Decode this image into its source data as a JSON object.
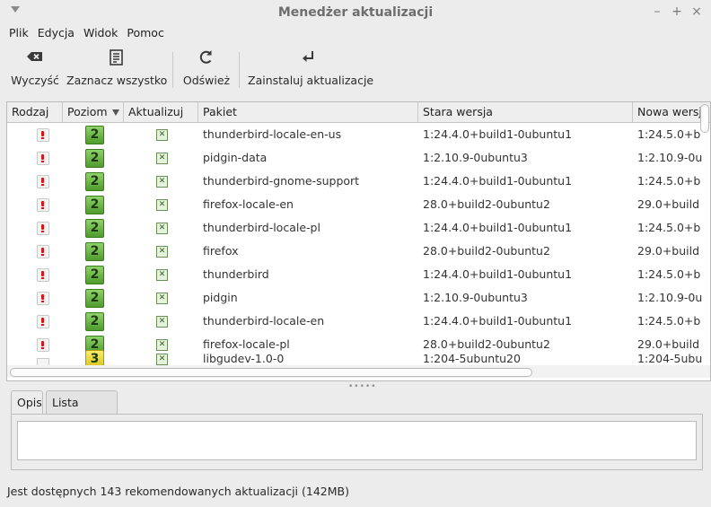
{
  "window": {
    "title": "Menedżer aktualizacji",
    "controls": [
      "–",
      "+",
      "×"
    ]
  },
  "menu": [
    "Plik",
    "Edycja",
    "Widok",
    "Pomoc"
  ],
  "toolbar": {
    "clear": "Wyczyść",
    "select_all": "Zaznacz wszystko",
    "refresh": "Odśwież",
    "install": "Zainstaluj aktualizacje"
  },
  "table": {
    "columns": [
      "Rodzaj",
      "Poziom",
      "Aktualizuj",
      "Pakiet",
      "Stara wersja",
      "Nowa wersja"
    ],
    "sorted_column": "Poziom",
    "rows": [
      {
        "type": "security",
        "level": "2",
        "update": true,
        "package": "thunderbird-locale-en-us",
        "old": "1:24.4.0+build1-0ubuntu1",
        "new": "1:24.5.0+b"
      },
      {
        "type": "security",
        "level": "2",
        "update": true,
        "package": "pidgin-data",
        "old": "1:2.10.9-0ubuntu3",
        "new": "1:2.10.9-0u"
      },
      {
        "type": "security",
        "level": "2",
        "update": true,
        "package": "thunderbird-gnome-support",
        "old": "1:24.4.0+build1-0ubuntu1",
        "new": "1:24.5.0+b"
      },
      {
        "type": "security",
        "level": "2",
        "update": true,
        "package": "firefox-locale-en",
        "old": "28.0+build2-0ubuntu2",
        "new": "29.0+build"
      },
      {
        "type": "security",
        "level": "2",
        "update": true,
        "package": "thunderbird-locale-pl",
        "old": "1:24.4.0+build1-0ubuntu1",
        "new": "1:24.5.0+b"
      },
      {
        "type": "security",
        "level": "2",
        "update": true,
        "package": "firefox",
        "old": "28.0+build2-0ubuntu2",
        "new": "29.0+build"
      },
      {
        "type": "security",
        "level": "2",
        "update": true,
        "package": "thunderbird",
        "old": "1:24.4.0+build1-0ubuntu1",
        "new": "1:24.5.0+b"
      },
      {
        "type": "security",
        "level": "2",
        "update": true,
        "package": "pidgin",
        "old": "1:2.10.9-0ubuntu3",
        "new": "1:2.10.9-0u"
      },
      {
        "type": "security",
        "level": "2",
        "update": true,
        "package": "thunderbird-locale-en",
        "old": "1:24.4.0+build1-0ubuntu1",
        "new": "1:24.5.0+b"
      },
      {
        "type": "security",
        "level": "2",
        "update": true,
        "package": "firefox-locale-pl",
        "old": "28.0+build2-0ubuntu2",
        "new": "29.0+build"
      },
      {
        "type": "package",
        "level": "3",
        "update": true,
        "package": "libgudev-1.0-0",
        "old": "1:204-5ubuntu20",
        "new": "1:204-5ubu"
      }
    ]
  },
  "tabs": [
    "Opis",
    "Lista zmian"
  ],
  "active_tab": "Opis",
  "status": "Jest dostępnych 143 rekomendowanych aktualizacji (142MB)",
  "icons": {
    "type_security": "exclamation-icon",
    "type_package": "document-icon",
    "level_2_color": "#5aa833",
    "level_3_color": "#e8d22a"
  }
}
